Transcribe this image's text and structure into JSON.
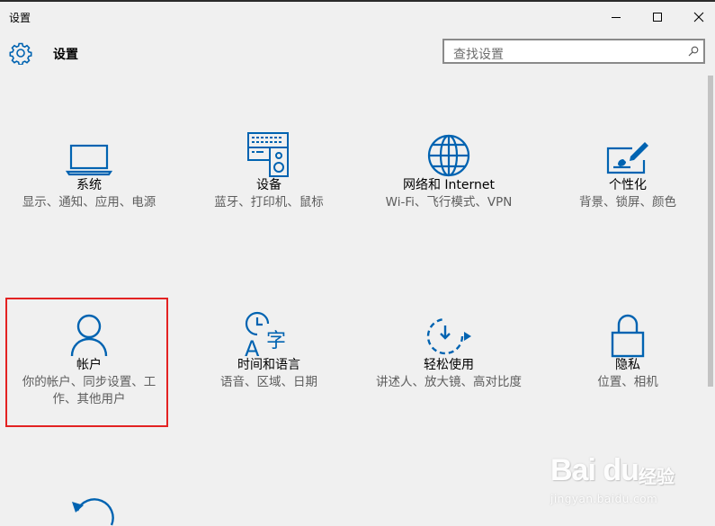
{
  "window": {
    "title": "设置",
    "controls": [
      "minimize-icon",
      "maximize-icon",
      "close-icon"
    ]
  },
  "header": {
    "icon": "gear-icon",
    "title": "设置",
    "search": {
      "placeholder": "查找设置",
      "icon": "search-icon"
    }
  },
  "tiles": [
    {
      "icon": "laptop-icon",
      "name": "系统",
      "desc": "显示、通知、应用、电源"
    },
    {
      "icon": "keyboard-speaker-icon",
      "name": "设备",
      "desc": "蓝牙、打印机、鼠标"
    },
    {
      "icon": "globe-icon",
      "name": "网络和 Internet",
      "desc": "Wi-Fi、飞行模式、VPN"
    },
    {
      "icon": "paint-screen-icon",
      "name": "个性化",
      "desc": "背景、锁屏、颜色"
    },
    {
      "icon": "person-icon",
      "name": "帐户",
      "desc": "你的帐户、同步设置、工作、其他用户"
    },
    {
      "icon": "time-language-icon",
      "name": "时间和语言",
      "desc": "语音、区域、日期"
    },
    {
      "icon": "ease-of-access-icon",
      "name": "轻松使用",
      "desc": "讲述人、放大镜、高对比度"
    },
    {
      "icon": "lock-icon",
      "name": "隐私",
      "desc": "位置、相机"
    },
    {
      "icon": "update-icon",
      "name": "",
      "desc": ""
    }
  ],
  "highlighted_tile": "帐户",
  "colors": {
    "accent": "#0063b1",
    "highlight": "#e32222",
    "background": "#f0f0f0"
  },
  "watermark": {
    "brand": "Bai du",
    "label": "经验",
    "url": "jingyan.baidu.com"
  }
}
